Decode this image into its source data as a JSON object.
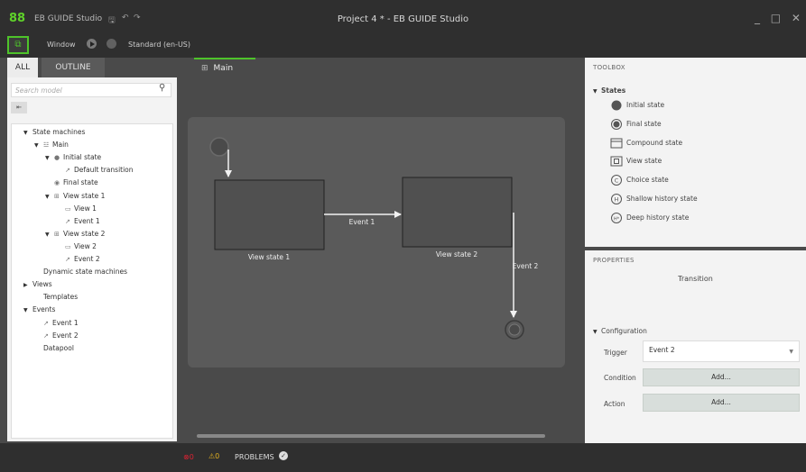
{
  "app": {
    "logo": "88",
    "title": "EB GUIDE Studio",
    "window_title": "Project 4 * - EB GUIDE Studio",
    "window_controls": "_ □ ✕",
    "toolbar_icons": [
      "save-icon",
      "undo-icon",
      "redo-icon"
    ]
  },
  "toolbar": {
    "layout_button": "⧉",
    "window_label": "Window",
    "language": "Standard (en-US)"
  },
  "left_panel": {
    "tabs": [
      "ALL",
      "OUTLINE"
    ],
    "search_placeholder": "Search model",
    "collapse_icon": "⇤",
    "tree": [
      {
        "label": "State machines",
        "level": 0,
        "expanded": true,
        "icon": ""
      },
      {
        "label": "Main",
        "level": 1,
        "expanded": true,
        "icon": "state-machine-icon"
      },
      {
        "label": "Initial state",
        "level": 2,
        "expanded": true,
        "icon": "initial-state-icon"
      },
      {
        "label": "Default transition",
        "level": 3,
        "expanded": null,
        "icon": "transition-icon"
      },
      {
        "label": "Final state",
        "level": 2,
        "expanded": null,
        "icon": "final-state-icon"
      },
      {
        "label": "View state 1",
        "level": 2,
        "expanded": true,
        "icon": "view-state-icon"
      },
      {
        "label": "View 1",
        "level": 3,
        "expanded": null,
        "icon": "view-icon"
      },
      {
        "label": "Event 1",
        "level": 3,
        "expanded": null,
        "icon": "transition-icon"
      },
      {
        "label": "View state 2",
        "level": 2,
        "expanded": true,
        "icon": "view-state-icon"
      },
      {
        "label": "View 2",
        "level": 3,
        "expanded": null,
        "icon": "view-icon"
      },
      {
        "label": "Event 2",
        "level": 3,
        "expanded": null,
        "icon": "transition-icon"
      },
      {
        "label": "Dynamic state machines",
        "level": 1,
        "expanded": null,
        "icon": ""
      },
      {
        "label": "Views",
        "level": 0,
        "expanded": false,
        "icon": ""
      },
      {
        "label": "Templates",
        "level": 1,
        "expanded": null,
        "icon": ""
      },
      {
        "label": "Events",
        "level": 0,
        "expanded": true,
        "icon": ""
      },
      {
        "label": "Event 1",
        "level": 1,
        "expanded": null,
        "icon": "event-icon"
      },
      {
        "label": "Event 2",
        "level": 1,
        "expanded": null,
        "icon": "event-icon"
      },
      {
        "label": "Datapool",
        "level": 1,
        "expanded": null,
        "icon": ""
      }
    ]
  },
  "editor": {
    "tab_label": "Main",
    "states": [
      {
        "name": "View state 1"
      },
      {
        "name": "View state 2"
      }
    ],
    "transitions": [
      {
        "label": "Event 1"
      },
      {
        "label": "Event 2"
      }
    ]
  },
  "toolbox": {
    "title": "TOOLBOX",
    "group": "States",
    "items": [
      {
        "label": "Initial state",
        "icon": "initial-state-icon"
      },
      {
        "label": "Final state",
        "icon": "final-state-icon"
      },
      {
        "label": "Compound state",
        "icon": "compound-state-icon"
      },
      {
        "label": "View state",
        "icon": "view-state-icon"
      },
      {
        "label": "Choice state",
        "icon": "choice-state-icon"
      },
      {
        "label": "Shallow history state",
        "icon": "shallow-history-icon"
      },
      {
        "label": "Deep history state",
        "icon": "deep-history-icon"
      }
    ]
  },
  "properties": {
    "title": "PROPERTIES",
    "subject": "Transition",
    "section": "Configuration",
    "trigger_label": "Trigger",
    "trigger_value": "Event 2",
    "condition_label": "Condition",
    "condition_button": "Add...",
    "action_label": "Action",
    "action_button": "Add..."
  },
  "status": {
    "errors": "0",
    "warnings": "0",
    "problems_label": "PROBLEMS"
  },
  "colors": {
    "accent": "#4ec32a",
    "title_bar": "#2f2f2f",
    "canvas": "#5a5a5a",
    "error": "#dd2233",
    "warning": "#e0b020"
  }
}
